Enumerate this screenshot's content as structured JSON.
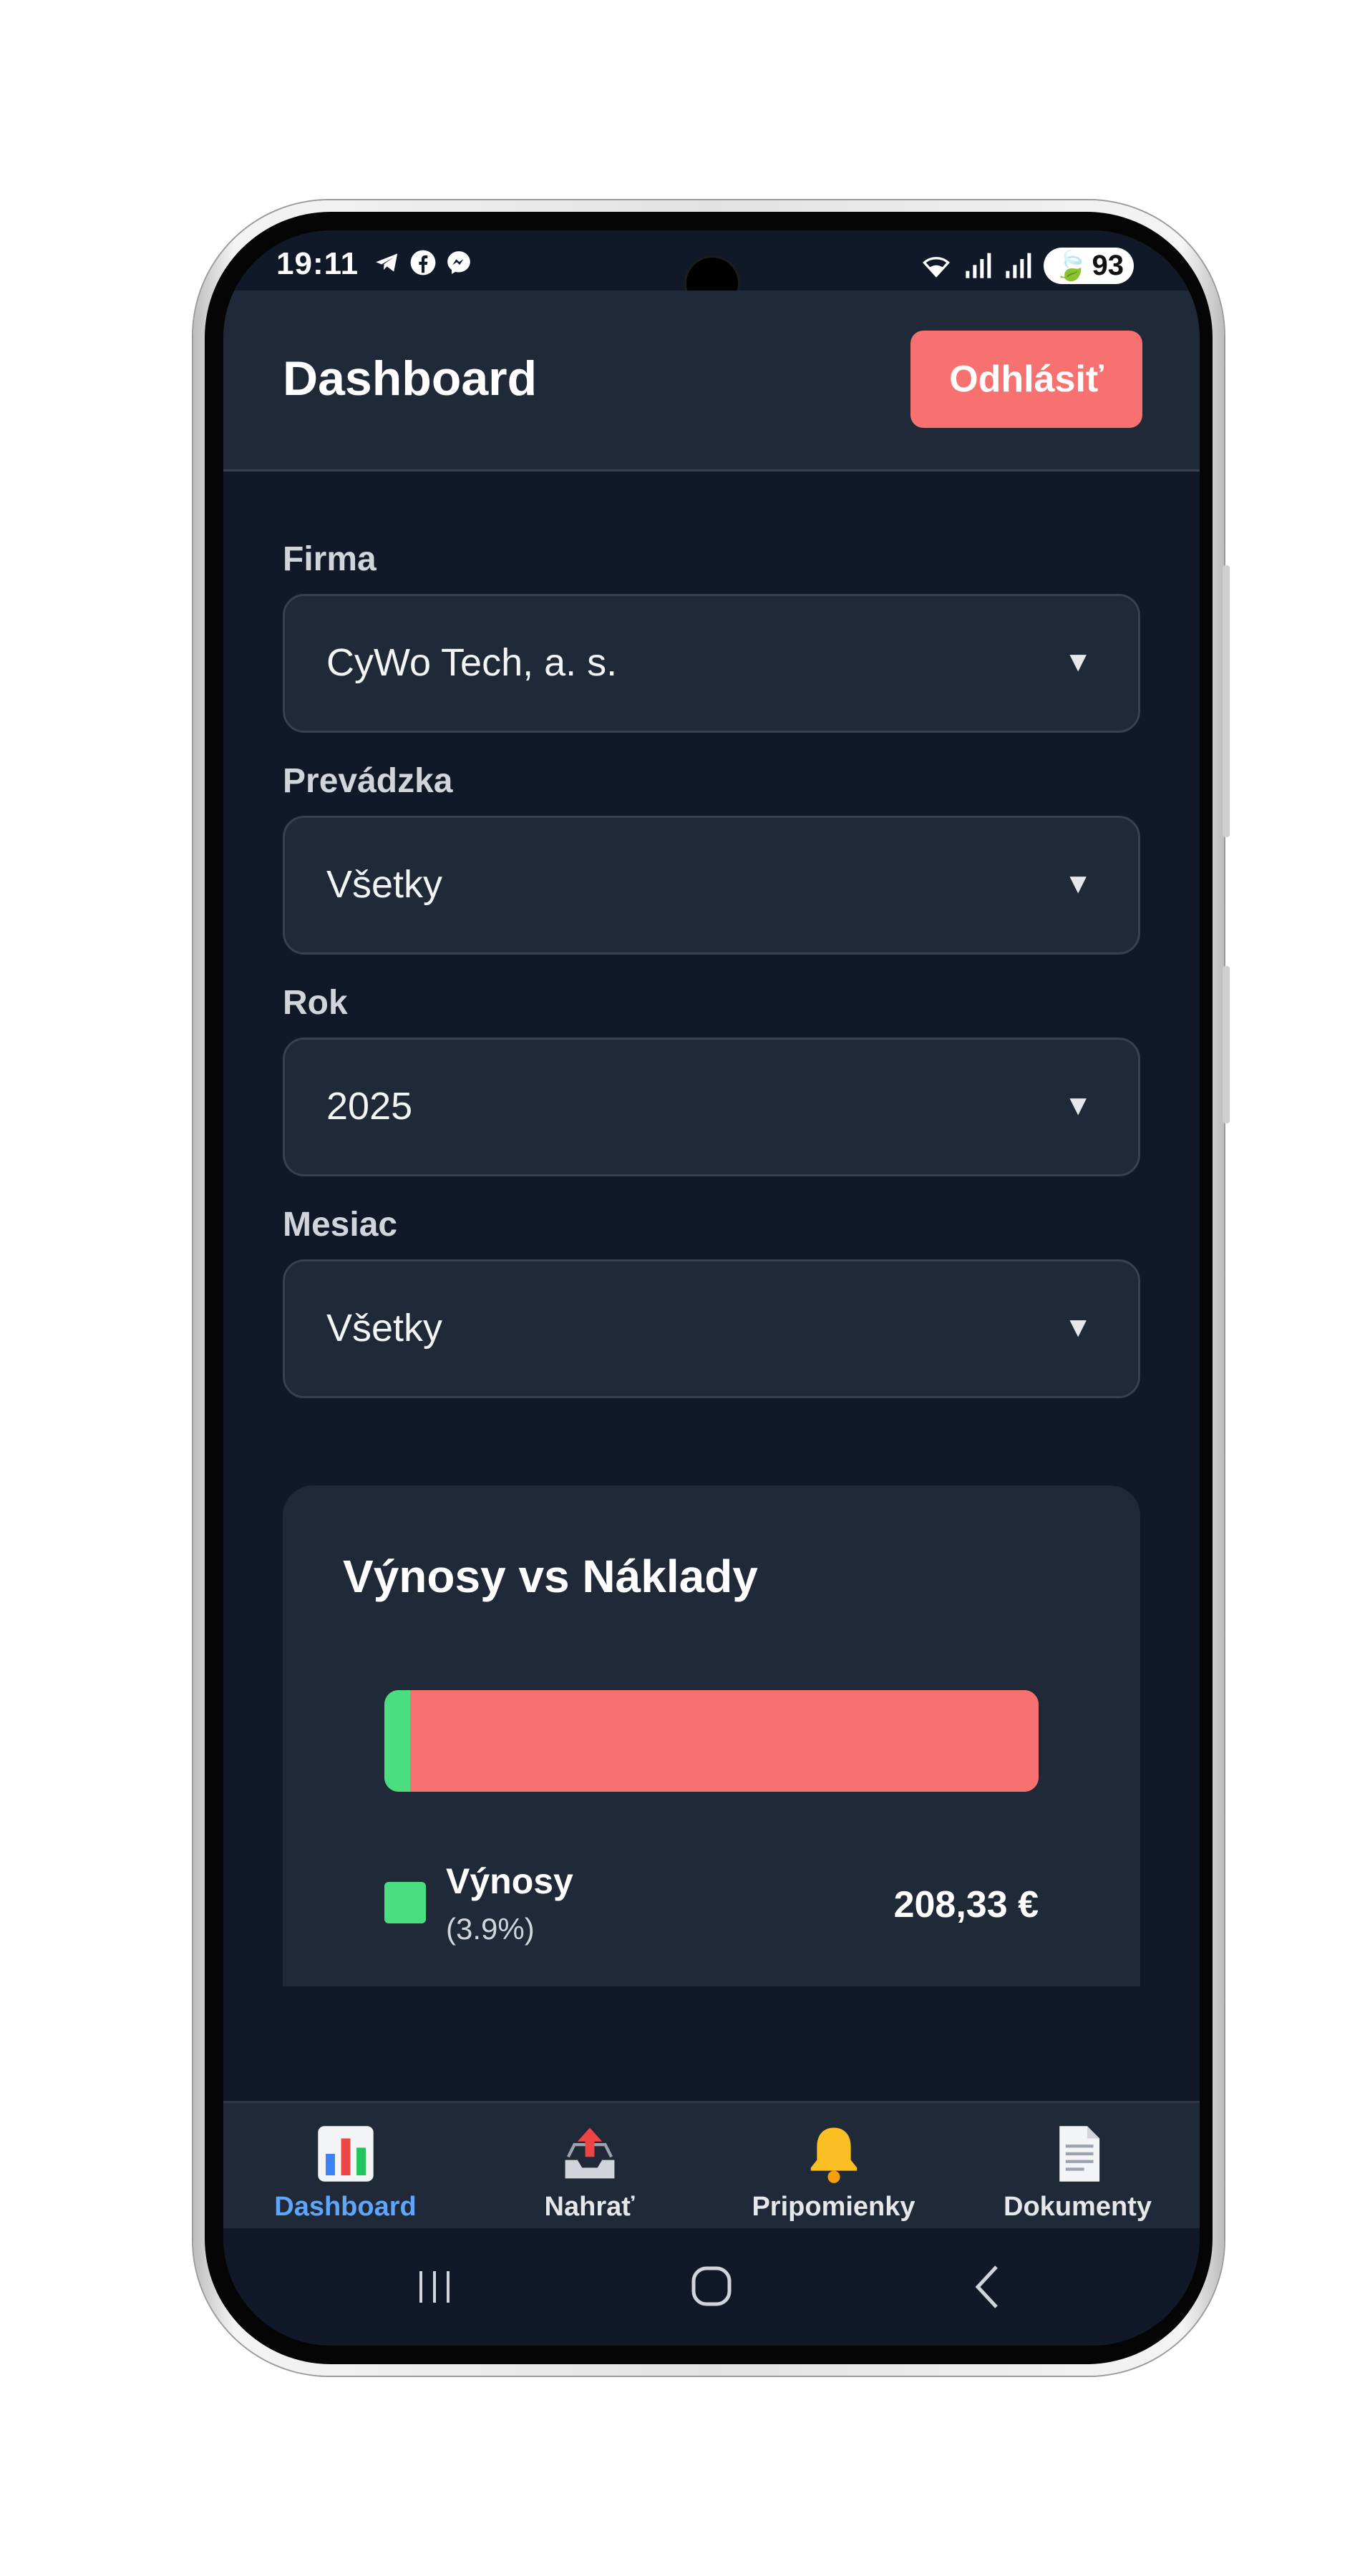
{
  "status_bar": {
    "time": "19:11",
    "app_icons": [
      "telegram-icon",
      "facebook-icon",
      "messenger-icon"
    ],
    "battery": "93"
  },
  "header": {
    "title": "Dashboard",
    "logout_label": "Odhlásiť"
  },
  "filters": [
    {
      "label": "Firma",
      "value": "CyWo Tech, a. s."
    },
    {
      "label": "Prevádzka",
      "value": "Všetky"
    },
    {
      "label": "Rok",
      "value": "2025"
    },
    {
      "label": "Mesiac",
      "value": "Všetky"
    }
  ],
  "select_arrow": "▼",
  "card": {
    "title": "Výnosy vs Náklady",
    "legend": [
      {
        "label": "Výnosy",
        "percent": "(3.9%)",
        "value": "208,33 €",
        "color": "#4ade80"
      }
    ]
  },
  "chart_data": {
    "type": "bar",
    "title": "Výnosy vs Náklady",
    "categories": [
      "Výnosy",
      "Náklady"
    ],
    "values_percent": [
      3.9,
      96.1
    ],
    "colors": [
      "#4ade80",
      "#f87171"
    ]
  },
  "bottom_nav": [
    {
      "label": "Dashboard",
      "icon": "bar-chart-icon",
      "active": true
    },
    {
      "label": "Nahrať",
      "icon": "upload-tray-icon",
      "active": false
    },
    {
      "label": "Pripomienky",
      "icon": "bell-icon",
      "active": false
    },
    {
      "label": "Dokumenty",
      "icon": "document-icon",
      "active": false
    }
  ],
  "colors": {
    "background": "#111827",
    "surface": "#1f2937",
    "accent_red": "#f87171",
    "accent_green": "#4ade80",
    "active_nav": "#60a5fa"
  }
}
